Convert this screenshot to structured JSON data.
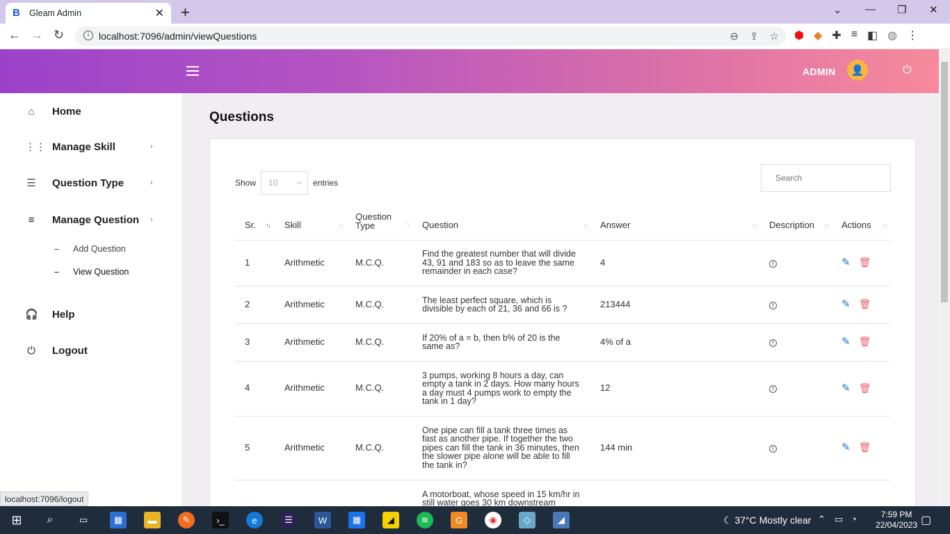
{
  "browser": {
    "tab_title": "Gleam Admin",
    "tab_favicon": "B",
    "url": "localhost:7096/admin/viewQuestions",
    "status_url": "localhost:7096/logout"
  },
  "header": {
    "user_label": "ADMIN"
  },
  "sidebar": {
    "items": [
      {
        "label": "Home",
        "icon": "home-icon"
      },
      {
        "label": "Manage Skill",
        "icon": "grid-icon"
      },
      {
        "label": "Question Type",
        "icon": "list-icon"
      },
      {
        "label": "Manage Question",
        "icon": "sort-icon"
      },
      {
        "label": "Help",
        "icon": "headset-icon"
      },
      {
        "label": "Logout",
        "icon": "power-icon"
      }
    ],
    "subitems": [
      {
        "label": "Add Question"
      },
      {
        "label": "View Question"
      }
    ]
  },
  "page": {
    "title": "Questions",
    "show_label": "Show",
    "entries_value": "10",
    "entries_label": "entries",
    "search_placeholder": "Search"
  },
  "table": {
    "headers": [
      "Sr.",
      "Skill",
      "Question Type",
      "Question",
      "Answer",
      "Description",
      "Actions"
    ],
    "rows": [
      {
        "sr": "1",
        "skill": "Arithmetic",
        "type": "M.C.Q.",
        "question": "Find the greatest number that will divide 43, 91 and 183 so as to leave the same remainder in each case?",
        "answer": "4"
      },
      {
        "sr": "2",
        "skill": "Arithmetic",
        "type": "M.C.Q.",
        "question": "The least perfect square, which is divisible by each of 21, 36 and 66 is ?",
        "answer": "213444"
      },
      {
        "sr": "3",
        "skill": "Arithmetic",
        "type": "M.C.Q.",
        "question": "If 20% of a = b, then b% of 20 is the same as?",
        "answer": "4% of a"
      },
      {
        "sr": "4",
        "skill": "Arithmetic",
        "type": "M.C.Q.",
        "question": "3 pumps, working 8 hours a day, can empty a tank in 2 days. How many hours a day must 4 pumps work to empty the tank in 1 day?",
        "answer": "12"
      },
      {
        "sr": "5",
        "skill": "Arithmetic",
        "type": "M.C.Q.",
        "question": "One pipe can fill a tank three times as fast as another pipe. If together the two pipes can fill the tank in 36 minutes, then the slower pipe alone will be able to fill the tank in?",
        "answer": "144 min"
      },
      {
        "sr": "",
        "skill": "",
        "type": "",
        "question": "A motorboat, whose speed in 15 km/hr in still water goes 30 km downstream",
        "answer": ""
      }
    ]
  },
  "taskbar": {
    "temperature": "37°C",
    "weather": "Mostly clear",
    "time": "7:59 PM",
    "date": "22/04/2023"
  }
}
